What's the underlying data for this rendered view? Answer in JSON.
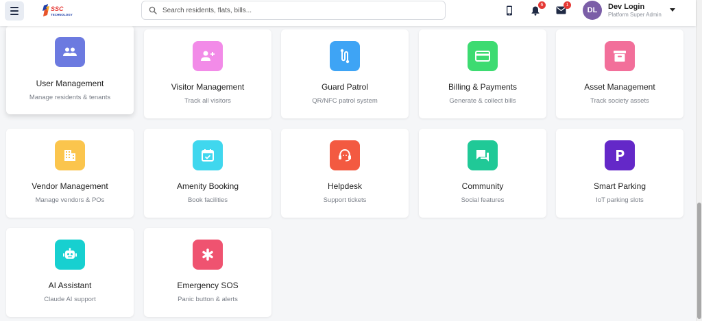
{
  "header": {
    "logo_text": "SSC",
    "logo_subtext": "TECHNOLOGY",
    "search_placeholder": "Search residents, flats, bills...",
    "notifications_count": "6",
    "messages_count": "1",
    "user": {
      "initials": "DL",
      "name": "Dev Login",
      "role": "Platform Super Admin"
    }
  },
  "colors": {
    "user_management": "#6c7ae0",
    "visitor_management": "#f28be8",
    "guard_patrol": "#3ea4f5",
    "billing_payments": "#3ddb71",
    "asset_management": "#f26f9a",
    "vendor_management": "#fbc54d",
    "amenity_booking": "#40d7ee",
    "helpdesk": "#f35a41",
    "community": "#20c997",
    "smart_parking": "#6428c8",
    "ai_assistant": "#17d0d0",
    "emergency_sos": "#ef5370"
  },
  "modules": [
    {
      "title": "User Management",
      "desc": "Manage residents & tenants",
      "icon": "users-icon"
    },
    {
      "title": "Visitor Management",
      "desc": "Track all visitors",
      "icon": "add-person-icon"
    },
    {
      "title": "Guard Patrol",
      "desc": "QR/NFC patrol system",
      "icon": "route-icon"
    },
    {
      "title": "Billing & Payments",
      "desc": "Generate & collect bills",
      "icon": "credit-card-icon"
    },
    {
      "title": "Asset Management",
      "desc": "Track society assets",
      "icon": "archive-box-icon"
    },
    {
      "title": "Vendor Management",
      "desc": "Manage vendors & POs",
      "icon": "building-icon"
    },
    {
      "title": "Amenity Booking",
      "desc": "Book facilities",
      "icon": "calendar-check-icon"
    },
    {
      "title": "Helpdesk",
      "desc": "Support tickets",
      "icon": "support-agent-icon"
    },
    {
      "title": "Community",
      "desc": "Social features",
      "icon": "chat-bubbles-icon"
    },
    {
      "title": "Smart Parking",
      "desc": "IoT parking slots",
      "icon": "parking-icon"
    },
    {
      "title": "AI Assistant",
      "desc": "Claude AI support",
      "icon": "robot-icon"
    },
    {
      "title": "Emergency SOS",
      "desc": "Panic button & alerts",
      "icon": "asterisk-icon"
    }
  ]
}
